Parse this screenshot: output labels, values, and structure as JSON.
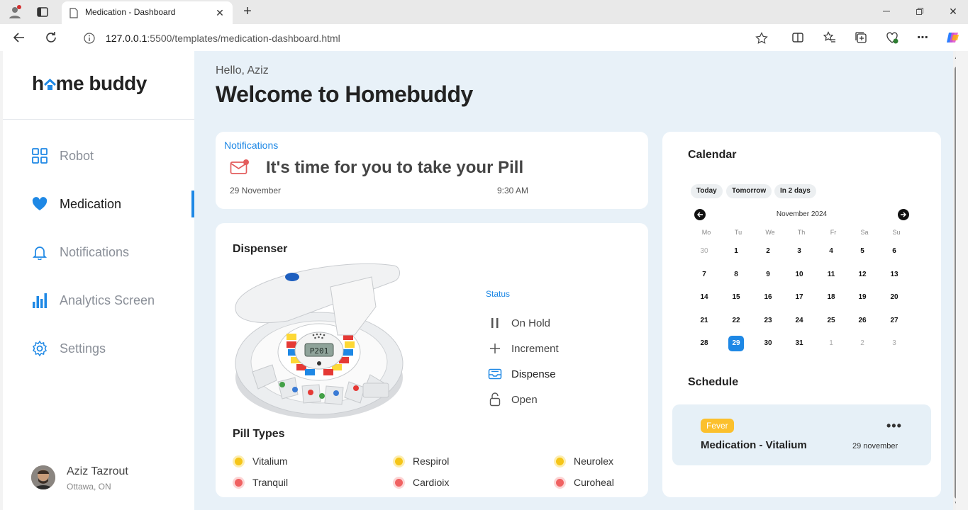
{
  "browser": {
    "tab_title": "Medication - Dashboard",
    "url_host": "127.0.0.1",
    "url_rest": ":5500/templates/medication-dashboard.html"
  },
  "sidebar": {
    "logo_left": "h",
    "logo_mid": "me buddy",
    "items": [
      {
        "label": "Robot",
        "icon": "grid-icon"
      },
      {
        "label": "Medication",
        "icon": "heart-icon",
        "active": true
      },
      {
        "label": "Notifications",
        "icon": "bell-icon"
      },
      {
        "label": "Analytics Screen",
        "icon": "bar-chart-icon"
      },
      {
        "label": "Settings",
        "icon": "gear-icon"
      }
    ],
    "user": {
      "name": "Aziz Tazrout",
      "location": "Ottawa, ON"
    }
  },
  "header": {
    "greeting": "Hello, Aziz",
    "title": "Welcome to Homebuddy"
  },
  "notification": {
    "label": "Notifications",
    "message": "It's time for you to take your Pill",
    "date": "29 November",
    "time": "9:30 AM"
  },
  "dispenser": {
    "title": "Dispenser",
    "status_label": "Status",
    "actions": [
      {
        "label": "On Hold",
        "icon": "pause-icon"
      },
      {
        "label": "Increment",
        "icon": "plus-icon"
      },
      {
        "label": "Dispense",
        "icon": "tray-icon",
        "active": true
      },
      {
        "label": "Open",
        "icon": "unlock-icon"
      }
    ],
    "lcd": "P201",
    "pill_types_title": "Pill Types",
    "pills": [
      {
        "name": "Vitalium",
        "color": "#f5c518"
      },
      {
        "name": "Respirol",
        "color": "#f5c518"
      },
      {
        "name": "Neurolex",
        "color": "#f5c518"
      },
      {
        "name": "Tranquil",
        "color": "#f06262"
      },
      {
        "name": "Cardioix",
        "color": "#f06262"
      },
      {
        "name": "Curoheal",
        "color": "#f06262"
      }
    ]
  },
  "calendar": {
    "title": "Calendar",
    "chips": [
      "Today",
      "Tomorrow",
      "In 2 days"
    ],
    "month": "November 2024",
    "weekdays": [
      "Mo",
      "Tu",
      "We",
      "Th",
      "Fr",
      "Sa",
      "Su"
    ],
    "weeks": [
      [
        "30",
        "1",
        "2",
        "3",
        "4",
        "5",
        "6"
      ],
      [
        "7",
        "8",
        "9",
        "10",
        "11",
        "12",
        "13"
      ],
      [
        "14",
        "15",
        "16",
        "17",
        "18",
        "19",
        "20"
      ],
      [
        "21",
        "22",
        "23",
        "24",
        "25",
        "26",
        "27"
      ],
      [
        "28",
        "29",
        "30",
        "31",
        "1",
        "2",
        "3"
      ]
    ],
    "selected": "29"
  },
  "schedule": {
    "title": "Schedule",
    "tag": "Fever",
    "item": "Medication - Vitalium",
    "date": "29 november"
  },
  "colors": {
    "accent": "#1e88e5",
    "bg": "#e8f1f8",
    "tag": "#fbc02d"
  }
}
